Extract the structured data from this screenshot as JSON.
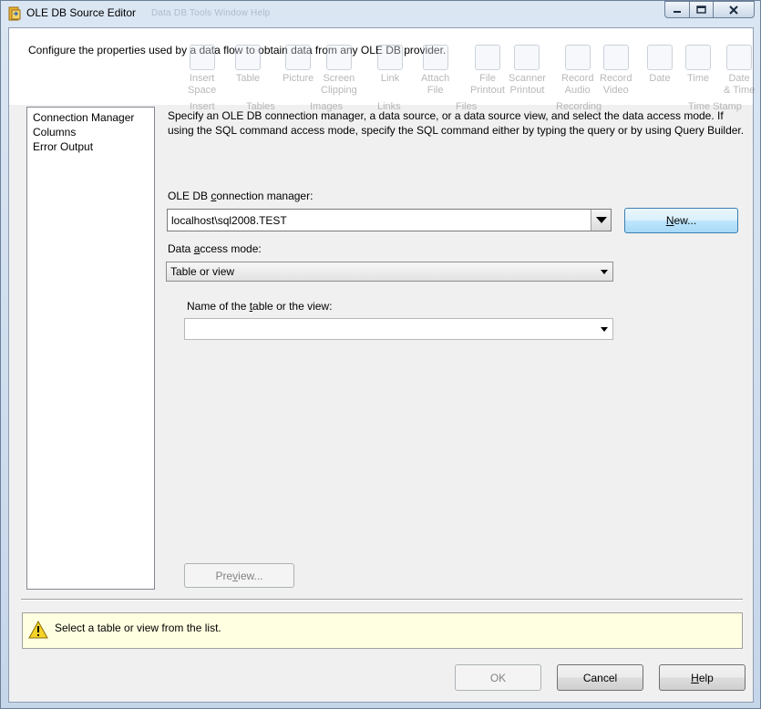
{
  "window": {
    "title": "OLE DB Source Editor",
    "ghost_menu": "Data   DB   Tools   Window   Help"
  },
  "header": {
    "text": "Configure the properties used by a data flow to obtain data from any OLE DB provider."
  },
  "ribbon_ghost": {
    "items": [
      {
        "label": "Insert\nSpace",
        "icon": "insert-space-icon"
      },
      {
        "label": "Table",
        "icon": "table-icon"
      },
      {
        "label": "Picture",
        "icon": "picture-icon"
      },
      {
        "label": "Screen\nClipping",
        "icon": "screen-clipping-icon"
      },
      {
        "label": "Link",
        "icon": "link-icon"
      },
      {
        "label": "Attach\nFile",
        "icon": "attach-file-icon"
      },
      {
        "label": "File\nPrintout",
        "icon": "file-printout-icon"
      },
      {
        "label": "Scanner\nPrintout",
        "icon": "scanner-icon"
      },
      {
        "label": "Record\nAudio",
        "icon": "microphone-icon"
      },
      {
        "label": "Record\nVideo",
        "icon": "video-icon"
      },
      {
        "label": "Date",
        "icon": "calendar-icon"
      },
      {
        "label": "Time",
        "icon": "clock-icon"
      },
      {
        "label": "Date\n& Time",
        "icon": "calendar-clock-icon"
      }
    ],
    "groups": [
      "Insert",
      "Tables",
      "Images",
      "Links",
      "Files",
      "Recording",
      "Time Stamp"
    ]
  },
  "nav": {
    "items": [
      {
        "label": "Connection Manager"
      },
      {
        "label": "Columns"
      },
      {
        "label": "Error Output"
      }
    ]
  },
  "main": {
    "description": "Specify an OLE DB connection manager, a data source, or a data source view, and select the data access mode. If using the SQL command access mode, specify the SQL command either by typing the query or by using Query Builder.",
    "connection_label_pre": "OLE DB ",
    "connection_label_accel": "c",
    "connection_label_post": "onnection manager:",
    "connection_value": "localhost\\sql2008.TEST",
    "new_button_accel": "N",
    "new_button_rest": "ew...",
    "access_label_pre": "Data ",
    "access_label_accel": "a",
    "access_label_post": "ccess mode:",
    "access_value": "Table or view",
    "table_label_pre": "Name of the ",
    "table_label_accel": "t",
    "table_label_post": "able or the view:",
    "table_value": "",
    "preview_pre": "Pre",
    "preview_accel": "v",
    "preview_post": "iew..."
  },
  "status": {
    "message": "Select a table or view from the list.",
    "icon": "warning-icon"
  },
  "footer": {
    "ok_label": "OK",
    "cancel_label": "Cancel",
    "help_accel": "H",
    "help_rest": "elp"
  }
}
